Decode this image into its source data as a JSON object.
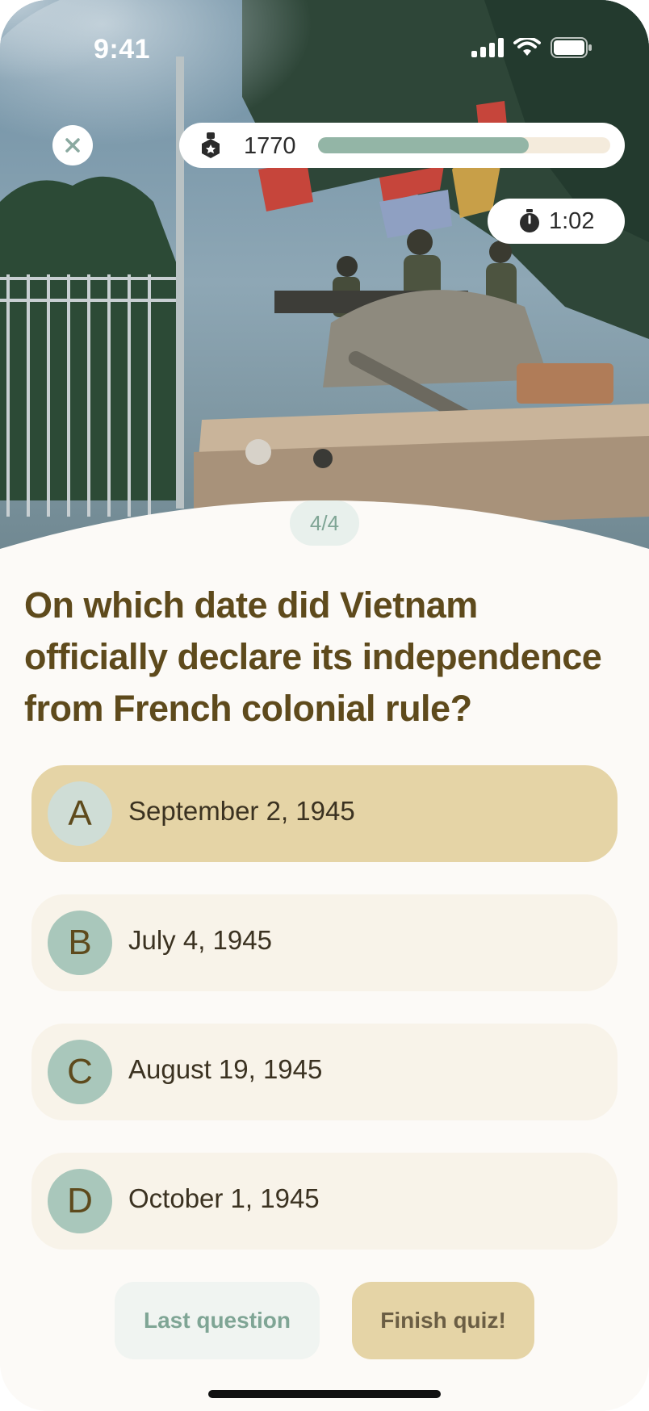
{
  "status_bar": {
    "time": "9:41",
    "icons": [
      "cellular-signal-icon",
      "wifi-icon",
      "battery-icon"
    ]
  },
  "header": {
    "close_icon": "close-icon",
    "score_icon": "medal-icon",
    "score": "1770",
    "progress": 0.72,
    "timer_icon": "stopwatch-icon",
    "timer": "1:02"
  },
  "quiz": {
    "counter": "4/4",
    "question": "On which date did Vietnam officially declare its independence from French colonial rule?",
    "options": [
      {
        "letter": "A",
        "text": "September 2, 1945",
        "selected": true
      },
      {
        "letter": "B",
        "text": "July 4, 1945",
        "selected": false
      },
      {
        "letter": "C",
        "text": "August 19, 1945",
        "selected": false
      },
      {
        "letter": "D",
        "text": "October 1, 1945",
        "selected": false
      }
    ]
  },
  "actions": {
    "last_question": "Last question",
    "finish": "Finish quiz!"
  },
  "colors": {
    "accent_green": "#93b5a6",
    "accent_gold": "#e5d4a6",
    "question_text": "#5e4a1c"
  }
}
